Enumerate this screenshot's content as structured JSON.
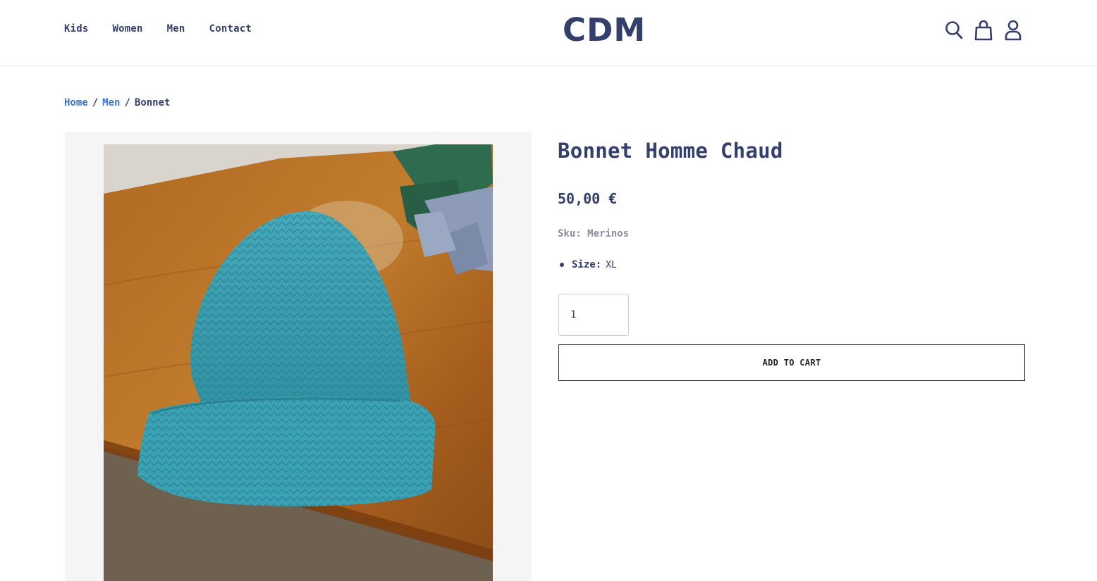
{
  "header": {
    "nav": [
      "Kids",
      "Women",
      "Men",
      "Contact"
    ],
    "logo": "CDM",
    "icons": [
      "search-icon",
      "bag-icon",
      "user-icon"
    ]
  },
  "breadcrumb": {
    "home": "Home",
    "category": "Men",
    "current": "Bonnet",
    "separator": "/"
  },
  "product": {
    "title": "Bonnet Homme Chaud",
    "price": "50,00 €",
    "sku_label": "Sku:",
    "sku_value": "Merinos",
    "attribute_name": "Size:",
    "attribute_value": "XL",
    "quantity": "1",
    "add_to_cart_label": "ADD TO CART"
  },
  "colors": {
    "primary": "#34406b",
    "link": "#3d76cf",
    "muted": "#8a8f9c",
    "gallery_bg": "#f5f5f5",
    "hat": "#3a9cad"
  }
}
